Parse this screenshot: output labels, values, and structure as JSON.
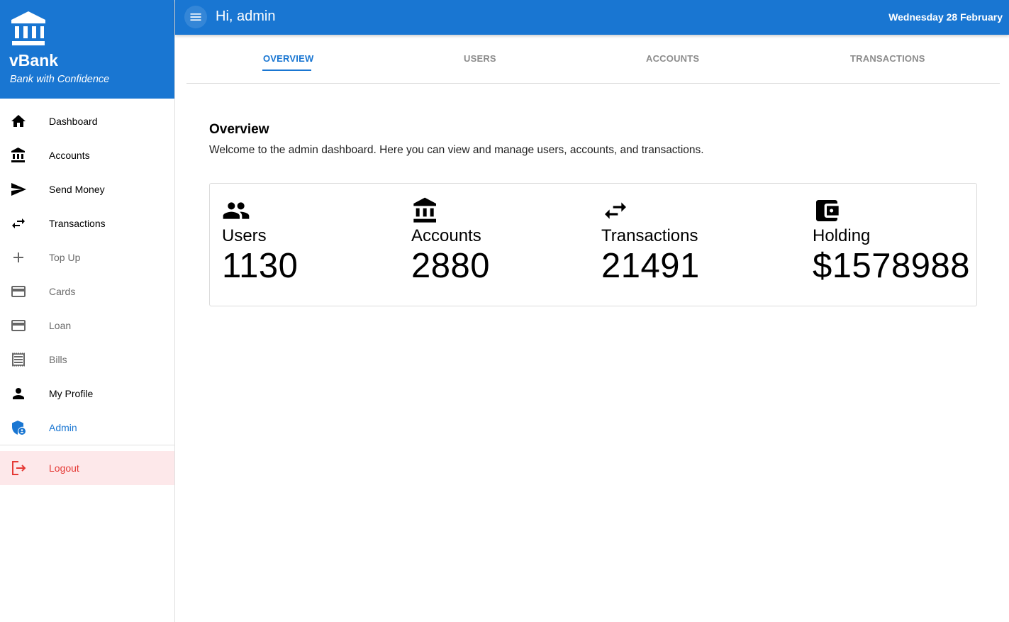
{
  "brand": {
    "name": "vBank",
    "tagline": "Bank with Confidence"
  },
  "sidebar": {
    "items": [
      {
        "label": "Dashboard",
        "icon": "home-icon"
      },
      {
        "label": "Accounts",
        "icon": "bank-icon"
      },
      {
        "label": "Send Money",
        "icon": "send-icon"
      },
      {
        "label": "Transactions",
        "icon": "swap-icon"
      },
      {
        "label": "Top Up",
        "icon": "plus-icon"
      },
      {
        "label": "Cards",
        "icon": "credit-card-icon"
      },
      {
        "label": "Loan",
        "icon": "credit-card-icon"
      },
      {
        "label": "Bills",
        "icon": "receipt-icon"
      },
      {
        "label": "My Profile",
        "icon": "person-icon"
      },
      {
        "label": "Admin",
        "icon": "admin-shield-icon"
      }
    ],
    "logout": {
      "label": "Logout",
      "icon": "logout-icon"
    }
  },
  "header": {
    "greeting": "Hi, admin",
    "date": "Wednesday 28 February"
  },
  "tabs": [
    {
      "label": "OVERVIEW",
      "active": true
    },
    {
      "label": "USERS",
      "active": false
    },
    {
      "label": "ACCOUNTS",
      "active": false
    },
    {
      "label": "TRANSACTIONS",
      "active": false
    }
  ],
  "overview": {
    "title": "Overview",
    "description": "Welcome to the admin dashboard. Here you can view and manage users, accounts, and transactions.",
    "stats": [
      {
        "label": "Users",
        "value": "1130",
        "icon": "people-icon"
      },
      {
        "label": "Accounts",
        "value": "2880",
        "icon": "bank-icon"
      },
      {
        "label": "Transactions",
        "value": "21491",
        "icon": "swap-icon"
      },
      {
        "label": "Holding",
        "value": "$1578988",
        "icon": "wallet-icon"
      }
    ]
  },
  "colors": {
    "primary": "#1976d2",
    "logout_bg": "#fde8ea",
    "logout_text": "#e53935"
  }
}
